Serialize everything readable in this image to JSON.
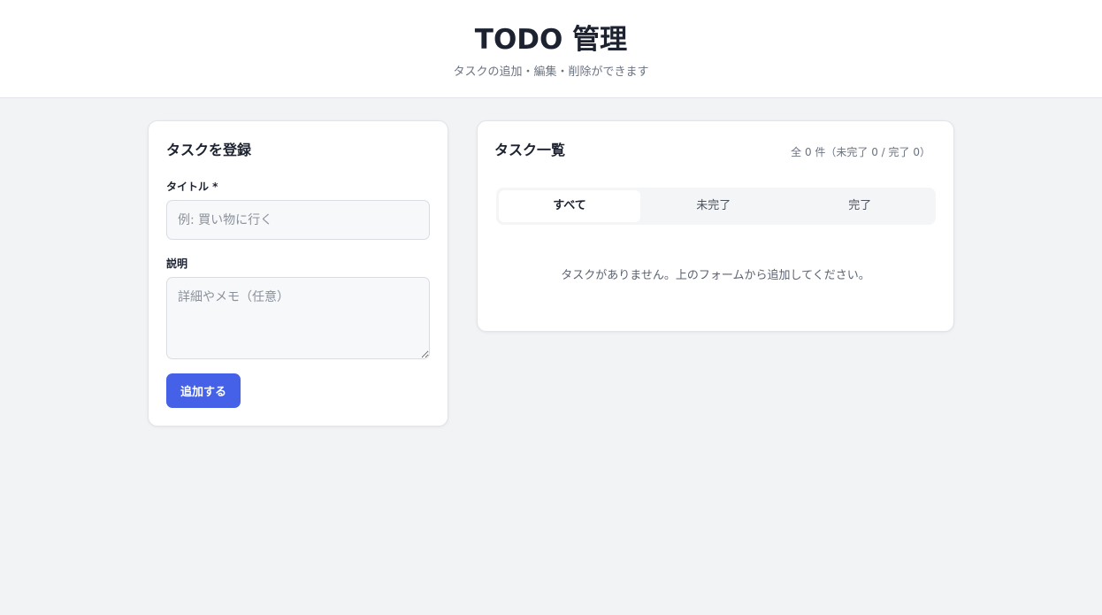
{
  "header": {
    "title": "TODO 管理",
    "subtitle": "タスクの追加・編集・削除ができます"
  },
  "form": {
    "heading": "タスクを登録",
    "title_label": "タイトル *",
    "title_placeholder": "例: 買い物に行く",
    "title_value": "",
    "desc_label": "説明",
    "desc_placeholder": "詳細やメモ（任意）",
    "desc_value": "",
    "submit_label": "追加する"
  },
  "list": {
    "heading": "タスク一覧",
    "count_text": "全 0 件（未完了 0 / 完了 0）",
    "tabs": [
      {
        "label": "すべて",
        "active": true
      },
      {
        "label": "未完了",
        "active": false
      },
      {
        "label": "完了",
        "active": false
      }
    ],
    "empty_message": "タスクがありません。上のフォームから追加してください。"
  },
  "colors": {
    "accent": "#4461e8",
    "background": "#f2f3f5"
  }
}
